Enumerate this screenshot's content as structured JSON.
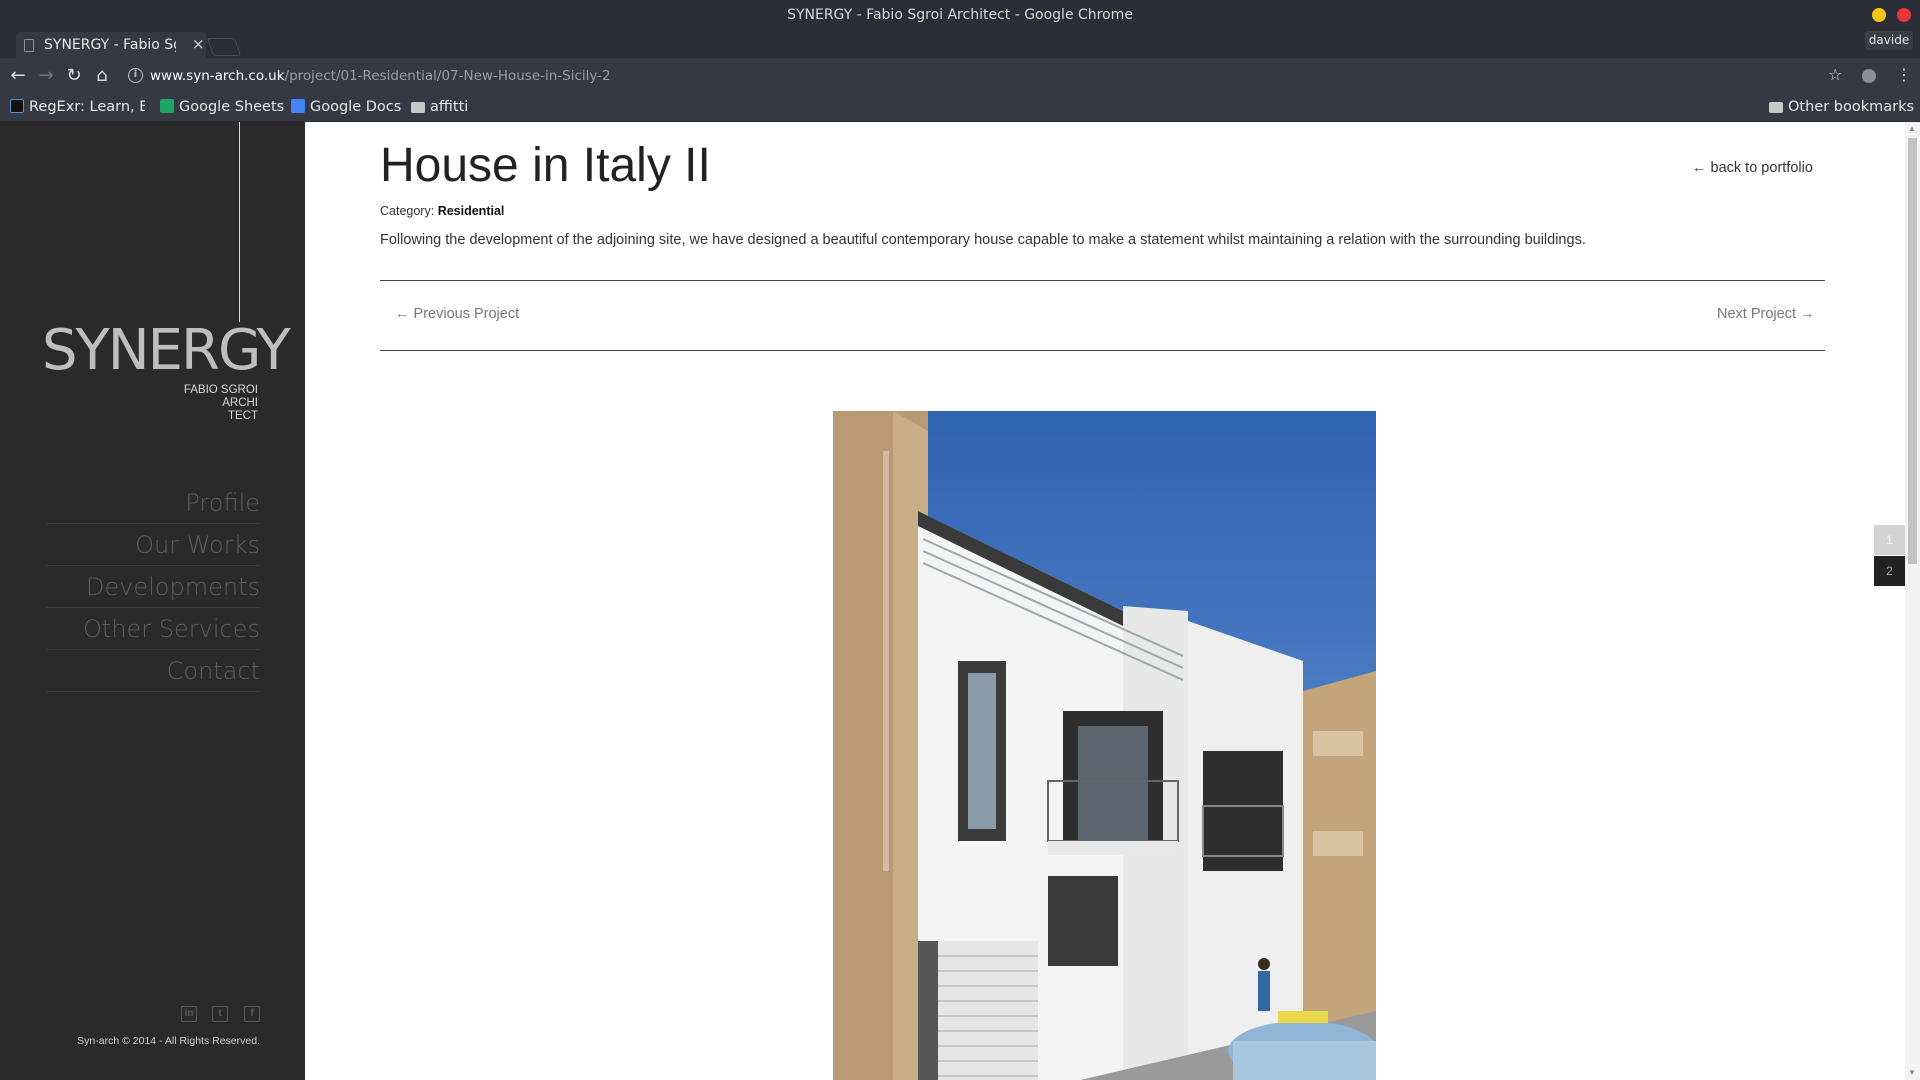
{
  "window": {
    "title": "SYNERGY - Fabio Sgroi Architect - Google Chrome",
    "profile_name": "davide"
  },
  "tab": {
    "title": "SYNERGY - Fabio Sgroi Architect",
    "close_glyph": "×"
  },
  "toolbar": {
    "back_glyph": "←",
    "forward_glyph": "→",
    "reload_glyph": "↻",
    "home_glyph": "⌂",
    "info_glyph": "i",
    "url_host": "www.syn-arch.co.uk",
    "url_path": "/project/01-Residential/07-New-House-in-Sicily-2",
    "star_glyph": "☆",
    "menu_glyph": "⋮"
  },
  "bookmarks": {
    "items": [
      {
        "label": "RegExr: Learn, Build, & Test RegEx",
        "icon": "regexr-icon"
      },
      {
        "label": "Google Sheets",
        "icon": "sheets-icon"
      },
      {
        "label": "Google Docs",
        "icon": "docs-icon"
      },
      {
        "label": "affitti",
        "icon": "folder-icon"
      }
    ],
    "other": "Other bookmarks"
  },
  "sidebar": {
    "logo_word": "SYNERGY",
    "logo_sub": [
      "FABIO SGROI",
      "ARCHI",
      "TECT"
    ],
    "menu": [
      "Profile",
      "Our Works",
      "Developments",
      "Other Services",
      "Contact"
    ],
    "social": [
      "linkedin-icon",
      "twitter-icon",
      "facebook-icon"
    ],
    "social_glyphs": [
      "in",
      "t",
      "f"
    ],
    "copyright": "Syn-arch © 2014 - All Rights Reserved."
  },
  "project": {
    "title": "House in Italy II",
    "back_link": "← back to portfolio",
    "category_label": "Category:",
    "category_value": "Residential",
    "description": "Following the development of the adjoining site, we have designed a beautiful contemporary house capable to make a statement whilst maintaining a relation with the surrounding buildings.",
    "prev": "← Previous Project",
    "next": "Next Project →"
  },
  "pager": [
    "1",
    "2"
  ],
  "colors": {
    "sidebar_bg": "#2a2a2a",
    "chrome_bg": "#363944",
    "sky": "#3d6fb8"
  }
}
